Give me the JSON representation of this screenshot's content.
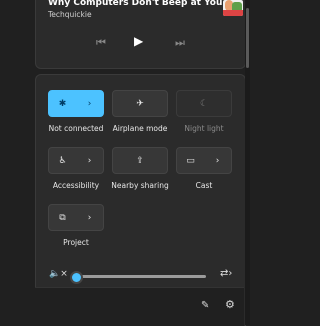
{
  "media": {
    "title": "Why Computers Don't Beep at You...",
    "channel": "Techquickie",
    "prev_icon": "previous-icon",
    "play_icon": "play-icon",
    "next_icon": "next-icon"
  },
  "tiles": [
    {
      "label": "Not connected",
      "active": true,
      "split": true,
      "icon": "bluetooth-icon"
    },
    {
      "label": "Airplane mode",
      "active": false,
      "split": false,
      "icon": "airplane-icon"
    },
    {
      "label": "Night light",
      "active": false,
      "disabled": true,
      "split": false,
      "icon": "night-light-icon"
    },
    {
      "label": "Accessibility",
      "active": false,
      "split": true,
      "icon": "accessibility-icon"
    },
    {
      "label": "Nearby sharing",
      "active": false,
      "split": false,
      "icon": "share-icon"
    },
    {
      "label": "Cast",
      "active": false,
      "split": true,
      "icon": "cast-icon"
    },
    {
      "label": "Project",
      "active": false,
      "split": true,
      "icon": "project-icon"
    }
  ],
  "volume": {
    "level": 0,
    "muted_icon": "volume-muted-icon",
    "output_icon": "audio-output-icon"
  },
  "footer": {
    "edit_icon": "edit-pencil-icon",
    "settings_icon": "settings-gear-icon"
  },
  "colors": {
    "accent": "#4cc2ff",
    "panel": "#2b2b2b",
    "background": "#202020"
  }
}
